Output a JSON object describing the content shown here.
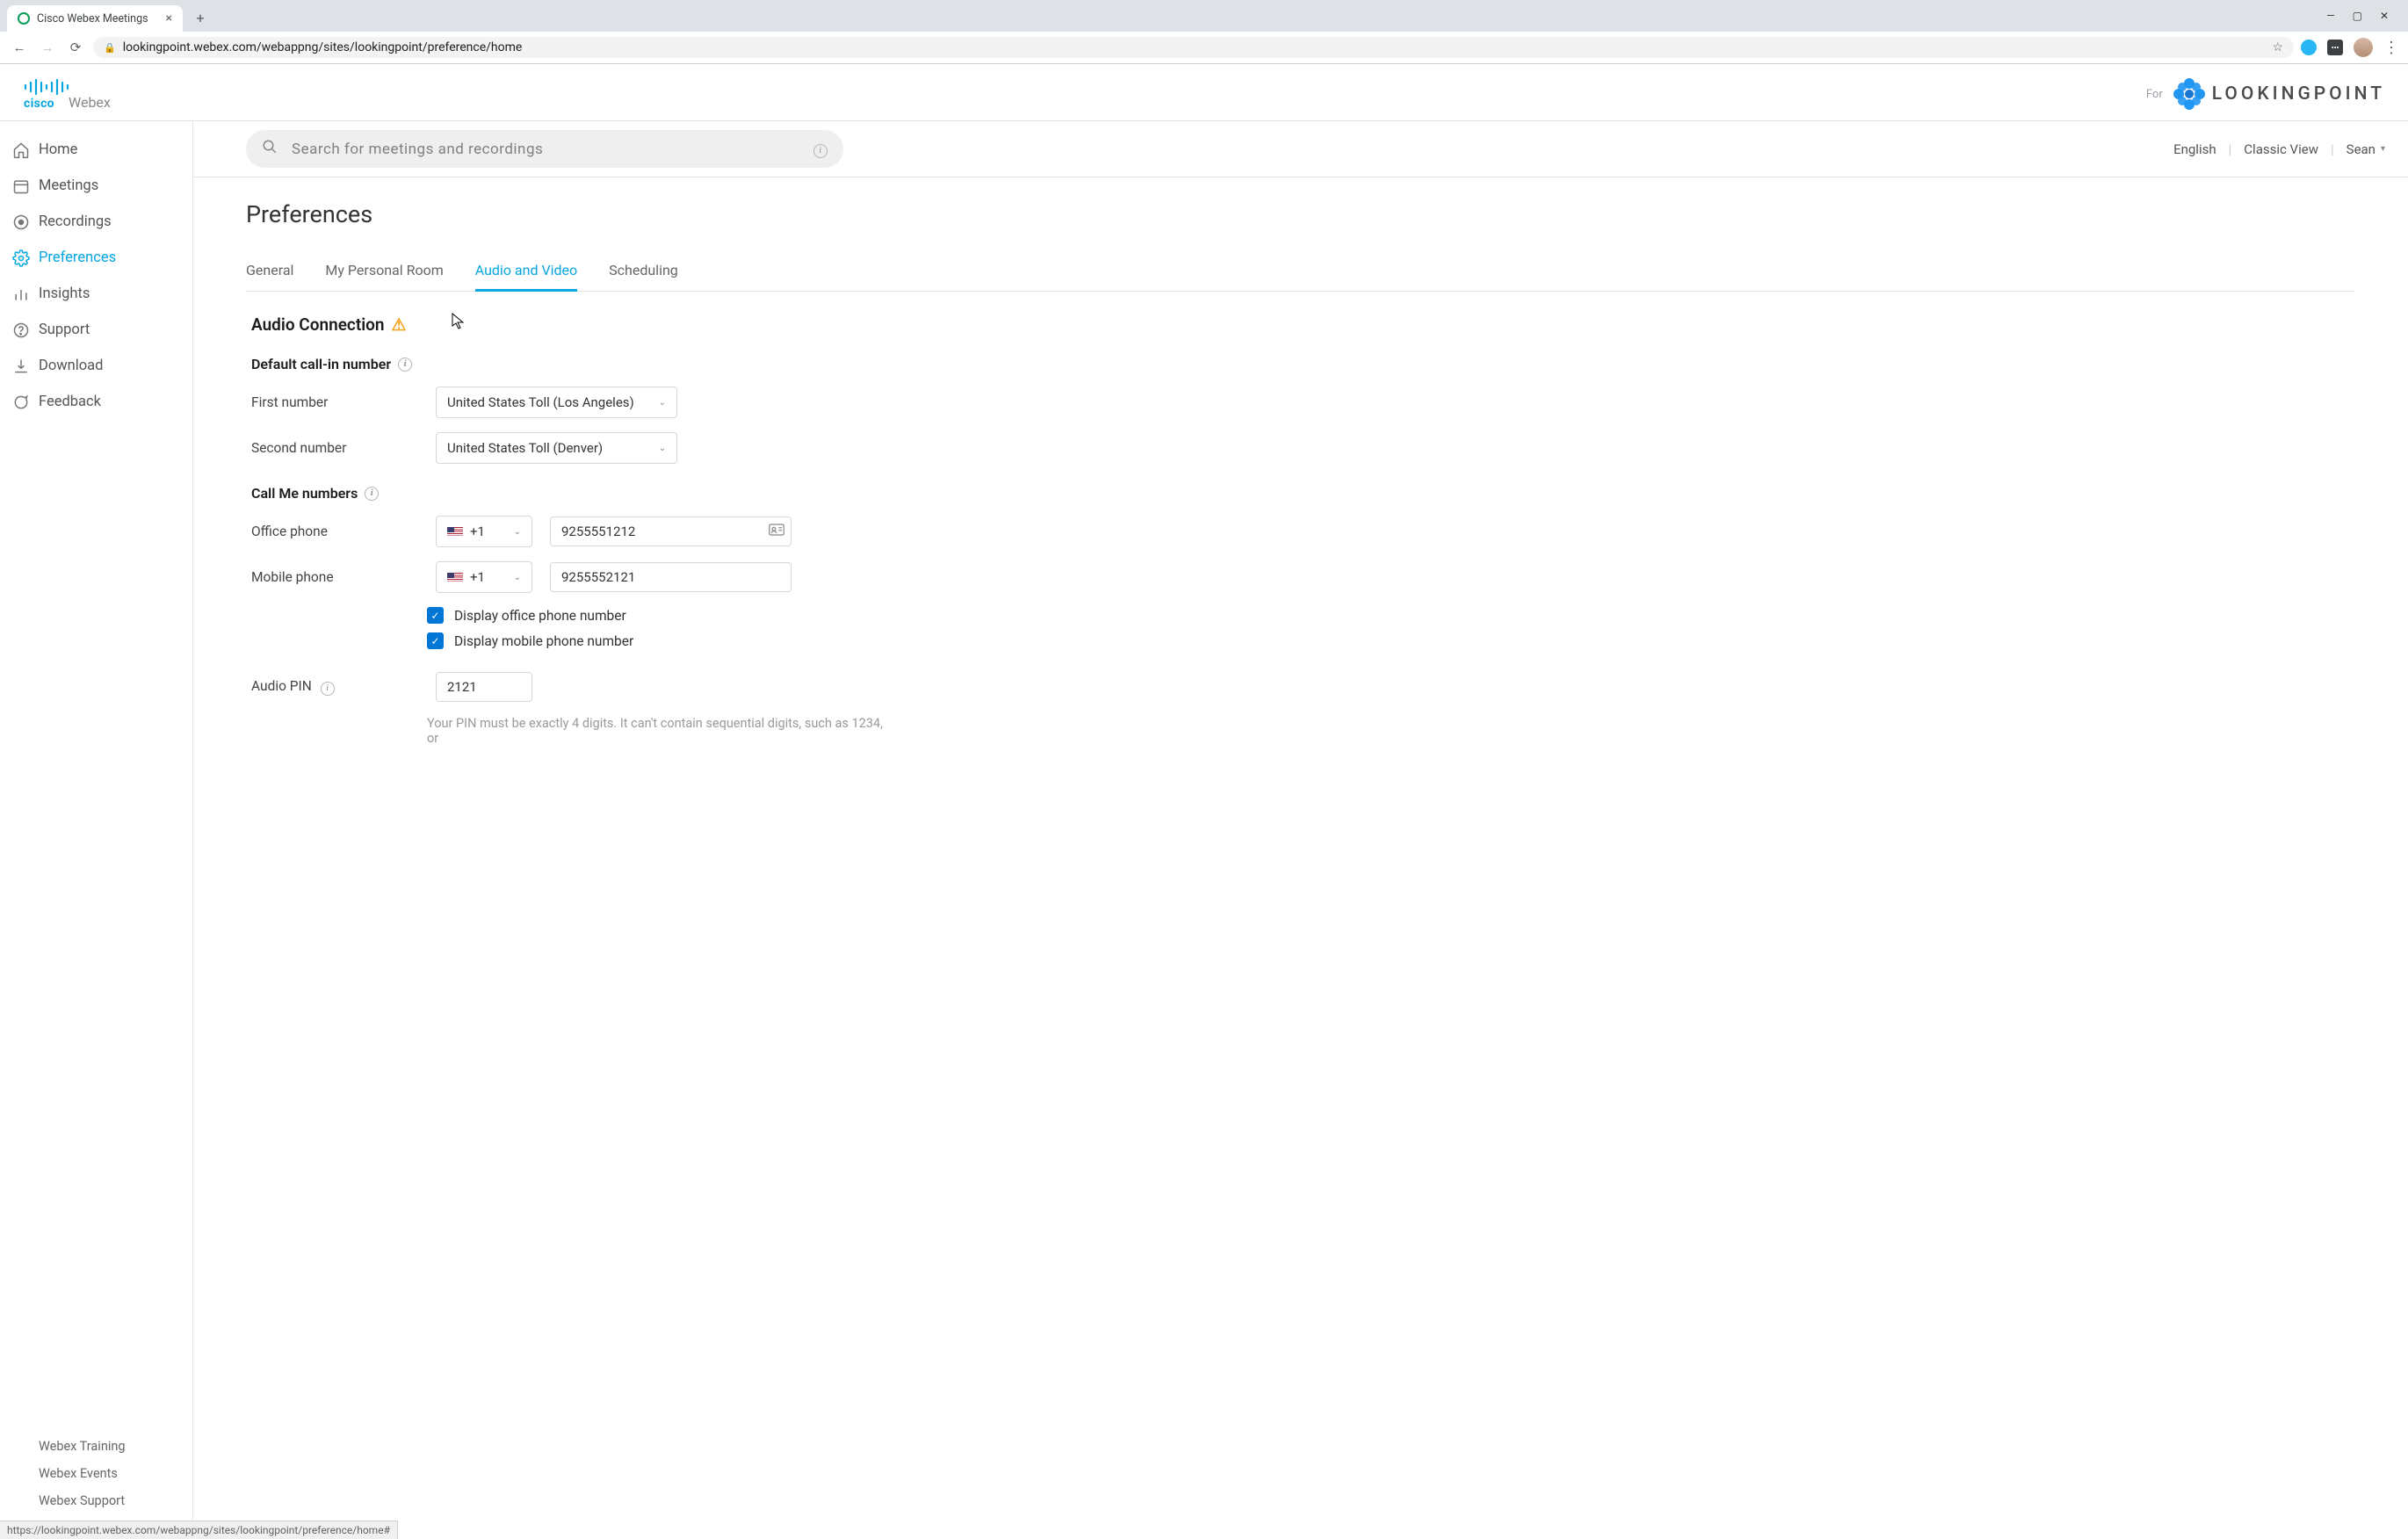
{
  "browser": {
    "tab_title": "Cisco Webex Meetings",
    "url": "lookingpoint.webex.com/webappng/sites/lookingpoint/preference/home",
    "status_url": "https://lookingpoint.webex.com/webappng/sites/lookingpoint/preference/home#"
  },
  "header": {
    "for_label": "For",
    "partner_brand": "LOOKINGPOINT"
  },
  "topbar": {
    "search_placeholder": "Search  for  meetings  and  recordings",
    "language": "English",
    "classic_view": "Classic View",
    "user_name": "Sean"
  },
  "sidebar": {
    "items": [
      {
        "label": "Home"
      },
      {
        "label": "Meetings"
      },
      {
        "label": "Recordings"
      },
      {
        "label": "Preferences"
      },
      {
        "label": "Insights"
      },
      {
        "label": "Support"
      },
      {
        "label": "Download"
      },
      {
        "label": "Feedback"
      }
    ],
    "bottom_items": [
      {
        "label": "Webex Training"
      },
      {
        "label": "Webex Events"
      },
      {
        "label": "Webex Support"
      }
    ]
  },
  "page": {
    "title": "Preferences",
    "tabs": [
      {
        "label": "General"
      },
      {
        "label": "My Personal Room"
      },
      {
        "label": "Audio and Video"
      },
      {
        "label": "Scheduling"
      }
    ],
    "audio": {
      "section_title": "Audio Connection",
      "default_callin_heading": "Default call-in number",
      "first_number_label": "First number",
      "first_number_value": "United States Toll (Los Angeles)",
      "second_number_label": "Second number",
      "second_number_value": "United States Toll (Denver)",
      "callme_heading": "Call Me numbers",
      "office_label": "Office phone",
      "mobile_label": "Mobile phone",
      "country_code": "+1",
      "office_value": "9255551212",
      "mobile_value": "9255552121",
      "display_office_label": "Display office phone number",
      "display_mobile_label": "Display mobile phone number",
      "audio_pin_label": "Audio PIN",
      "audio_pin_value": "2121",
      "pin_help": "Your PIN must be exactly 4 digits. It can't contain sequential digits, such as 1234, or"
    }
  }
}
